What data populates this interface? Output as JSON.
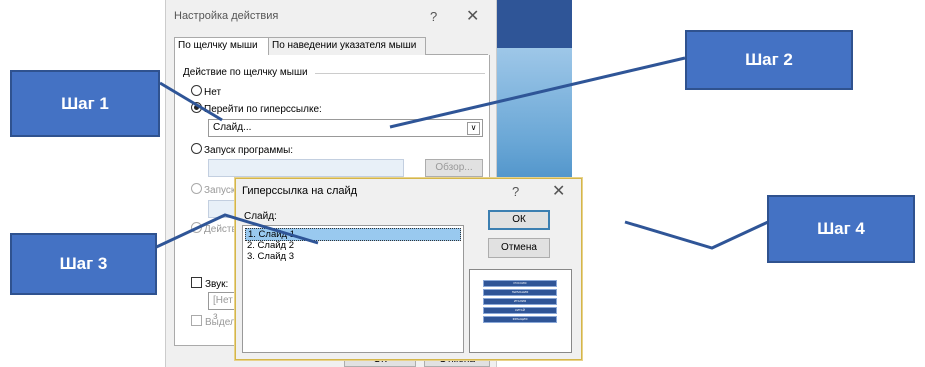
{
  "action_dialog": {
    "title": "Настройка действия",
    "help": "?",
    "close": "✕",
    "tabs": [
      {
        "label": "По щелчку мыши",
        "active": true
      },
      {
        "label": "По наведении указателя мыши",
        "active": false
      }
    ],
    "group_label": "Действие по щелчку мыши",
    "options": {
      "none": "Нет",
      "hyperlink": "Перейти по гиперссылке:",
      "hyperlink_value": "Слайд...",
      "run_program": "Запуск программы:",
      "browse": "Обзор...",
      "run_macro": "Запуск",
      "action": "Действ"
    },
    "sound_label": "Звук:",
    "sound_value": "[Нет з",
    "highlight_label": "Выдел",
    "ok": "ОК",
    "cancel": "Отмена"
  },
  "slide_dialog": {
    "title": "Гиперссылка на слайд",
    "help": "?",
    "close": "✕",
    "list_label": "Слайд:",
    "items": [
      "1. Слайд 1",
      "2. Слайд 2",
      "3. Слайд 3"
    ],
    "selected_index": 0,
    "ok": "ОК",
    "cancel": "Отмена",
    "preview_rows": [
      "РОССИЯ",
      "ГЕРМАНИЯ",
      "ИТАЛИЯ",
      "КИТАЙ",
      "ФРАНЦИЯ"
    ]
  },
  "steps": [
    "Шаг 1",
    "Шаг 2",
    "Шаг 3",
    "Шаг 4"
  ],
  "colors": {
    "step_fill": "#4472c4",
    "step_border": "#2f528f",
    "arrow": "#2f5597",
    "selection": "#99c9ef"
  }
}
